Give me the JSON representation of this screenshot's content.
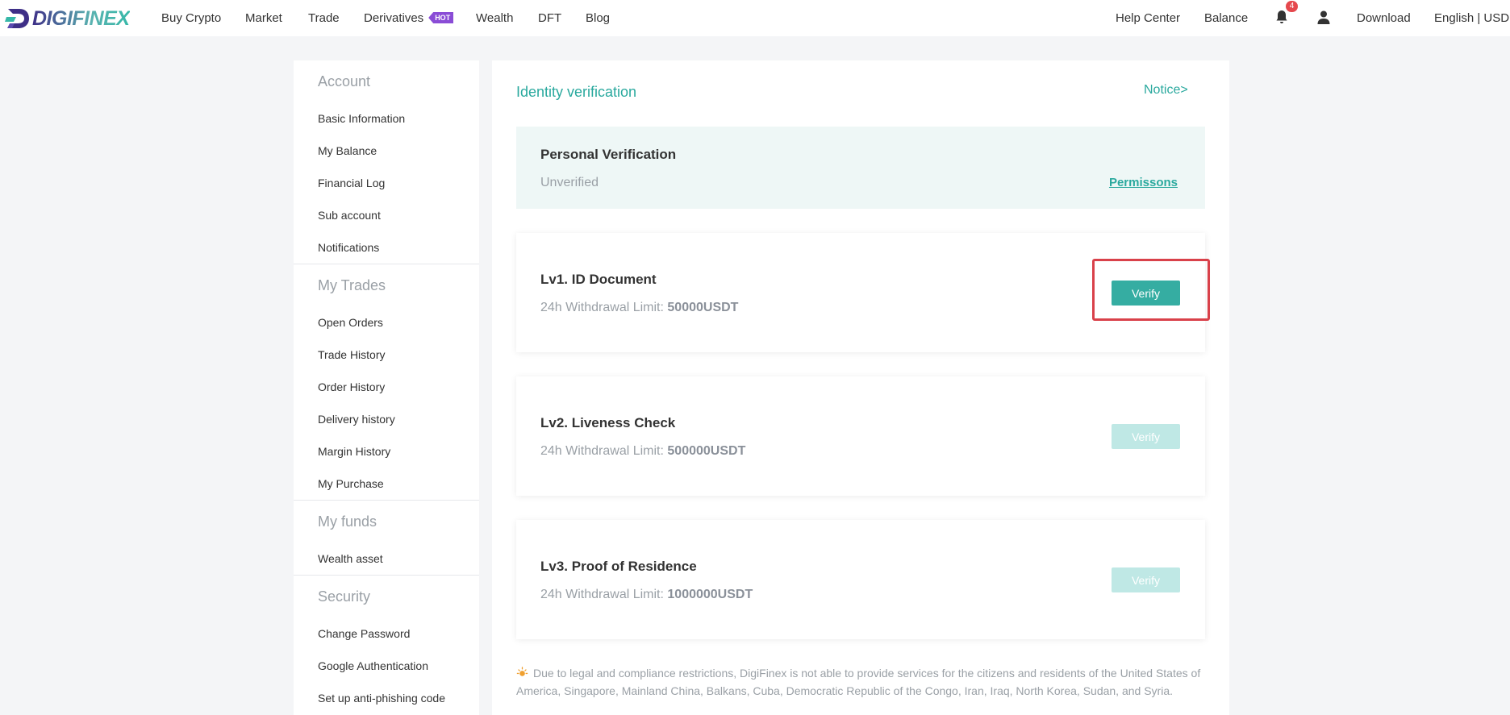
{
  "brand": {
    "name": "DIGIFINEX"
  },
  "nav": {
    "left": [
      "Buy Crypto",
      "Market",
      "Trade",
      "Derivatives",
      "Wealth",
      "DFT",
      "Blog"
    ],
    "hot_badge": "HOT",
    "right": [
      "Help Center",
      "Balance",
      "Download",
      "English | USD"
    ],
    "notification_count": "4"
  },
  "sidebar": {
    "sections": [
      {
        "title": "Account",
        "items": [
          "Basic Information",
          "My Balance",
          "Financial Log",
          "Sub account",
          "Notifications"
        ]
      },
      {
        "title": "My Trades",
        "items": [
          "Open Orders",
          "Trade History",
          "Order History",
          "Delivery history",
          "Margin History",
          "My Purchase"
        ]
      },
      {
        "title": "My funds",
        "items": [
          "Wealth asset"
        ]
      },
      {
        "title": "Security",
        "items": [
          "Change Password",
          "Google Authentication",
          "Set up anti-phishing code"
        ]
      }
    ]
  },
  "main": {
    "title": "Identity verification",
    "notice": "Notice>",
    "personal": {
      "title": "Personal Verification",
      "status": "Unverified",
      "permissions": "Permissons"
    },
    "limit_label": "24h Withdrawal Limit: ",
    "levels": [
      {
        "title": "Lv1. ID Document",
        "limit": "50000USDT",
        "button": "Verify",
        "enabled": true
      },
      {
        "title": "Lv2. Liveness Check",
        "limit": "500000USDT",
        "button": "Verify",
        "enabled": false
      },
      {
        "title": "Lv3. Proof of Residence",
        "limit": "1000000USDT",
        "button": "Verify",
        "enabled": false
      }
    ],
    "disclaimer": "Due to legal and compliance restrictions, DigiFinex is not able to provide services for the citizens and residents of the United States of America, Singapore, Mainland China, Balkans, Cuba, Democratic Republic of the Congo, Iran, Iraq, North Korea, Sudan, and Syria."
  },
  "colors": {
    "accent": "#35ada2",
    "highlight": "#d9414a",
    "hot": "#8a4cd6"
  }
}
